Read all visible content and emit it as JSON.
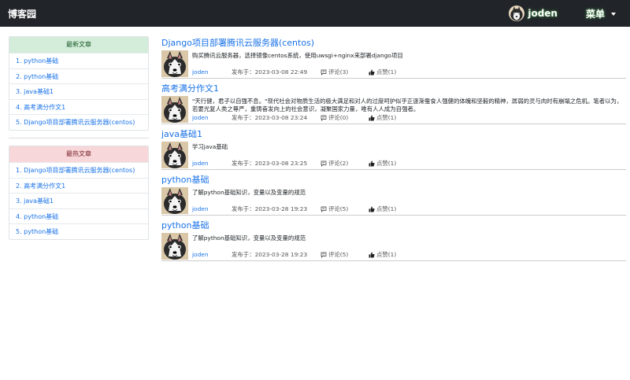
{
  "navbar": {
    "brand": "博客园",
    "user_name": "joden",
    "menu_label": "菜单"
  },
  "sidebar": {
    "latest": {
      "header": "最新文章",
      "items": [
        "1. python基础",
        "2. python基础",
        "3. java基础1",
        "4. 高考满分作文1",
        "5. Django项目部署腾讯云服务器(centos)"
      ]
    },
    "hottest": {
      "header": "最热文章",
      "items": [
        "1. Django项目部署腾讯云服务器(centos)",
        "2. 高考满分作文1",
        "3. java基础1",
        "4. python基础",
        "5. python基础"
      ]
    }
  },
  "posts": [
    {
      "title": "Django项目部署腾讯云服务器(centos)",
      "summary": "购买腾讯云服务器，选择镜像centos系统，使用uwsgi+nginx来部署django项目",
      "author": "joden",
      "date": "发布于：2023-03-08 22:49",
      "comments": "评论(3)",
      "likes": "点赞(1)"
    },
    {
      "title": "高考满分作文1",
      "summary": "\"天行健，君子以自强不息。\"现代社会对物质生活的极大满足和对人的过度呵护似乎正逐渐蚕食人强健的体魄和坚毅的精神，孱弱的灵与肉时有崩塌之危机。笔者以为，若要光复人类之尊严，重铸奋发向上的社会意识，凝聚国家力量，唯有人人成为自强者。",
      "author": "joden",
      "date": "发布于：2023-03-08 23:24",
      "comments": "评论(0)",
      "likes": "点赞(1)"
    },
    {
      "title": "java基础1",
      "summary": "学习java基础",
      "author": "joden",
      "date": "发布于：2023-03-08 23:25",
      "comments": "评论(2)",
      "likes": "点赞(1)"
    },
    {
      "title": "python基础",
      "summary": "了解python基础知识，变量以及变量的规范",
      "author": "joden",
      "date": "发布于：2023-03-28 19:23",
      "comments": "评论(5)",
      "likes": "点赞(1)"
    },
    {
      "title": "python基础",
      "summary": "了解python基础知识，变量以及变量的规范",
      "author": "joden",
      "date": "发布于：2023-03-28 19:23",
      "comments": "评论(5)",
      "likes": "点赞(1)"
    }
  ],
  "icons": {
    "comment": "comment-icon",
    "like": "thumbs-up-icon",
    "avatar": "husky-dog-avatar"
  },
  "colors": {
    "navbar": "#212529",
    "link": "#1a73e8",
    "latest_header": "#d4edda",
    "hottest_header": "#f8d7da"
  }
}
